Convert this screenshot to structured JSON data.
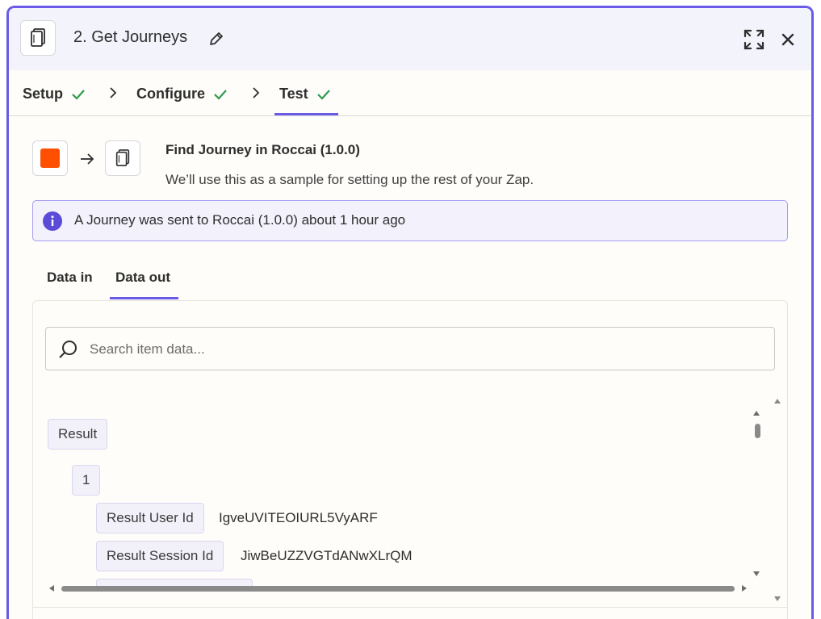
{
  "header": {
    "title": "2. Get Journeys",
    "app_icon": "copy-pages-icon",
    "edit_icon": "pencil-icon",
    "expand_icon": "expand-icon",
    "close_icon": "close-icon"
  },
  "steps": [
    {
      "label": "Setup",
      "done": true
    },
    {
      "label": "Configure",
      "done": true
    },
    {
      "label": "Test",
      "done": true,
      "active": true
    }
  ],
  "test": {
    "title": "Find Journey in Roccai (1.0.0)",
    "subtitle": "We’ll use this as a sample for setting up the rest of your Zap.",
    "info": "A Journey was sent to Roccai (1.0.0) about 1 hour ago"
  },
  "data_tabs": [
    {
      "label": "Data in"
    },
    {
      "label": "Data out",
      "active": true
    }
  ],
  "search": {
    "placeholder": "Search item data...",
    "value": ""
  },
  "tree": {
    "root": "Result",
    "index": "1",
    "fields": [
      {
        "key": "Result User Id",
        "value": "IgveUVITEOIURL5VyARF"
      },
      {
        "key": "Result Session Id",
        "value": "JiwBeUZZVGTdANwXLrQM"
      }
    ]
  },
  "colors": {
    "accent": "#695be8",
    "success": "#2d9a4e",
    "brand_orange": "#ff4f00"
  }
}
